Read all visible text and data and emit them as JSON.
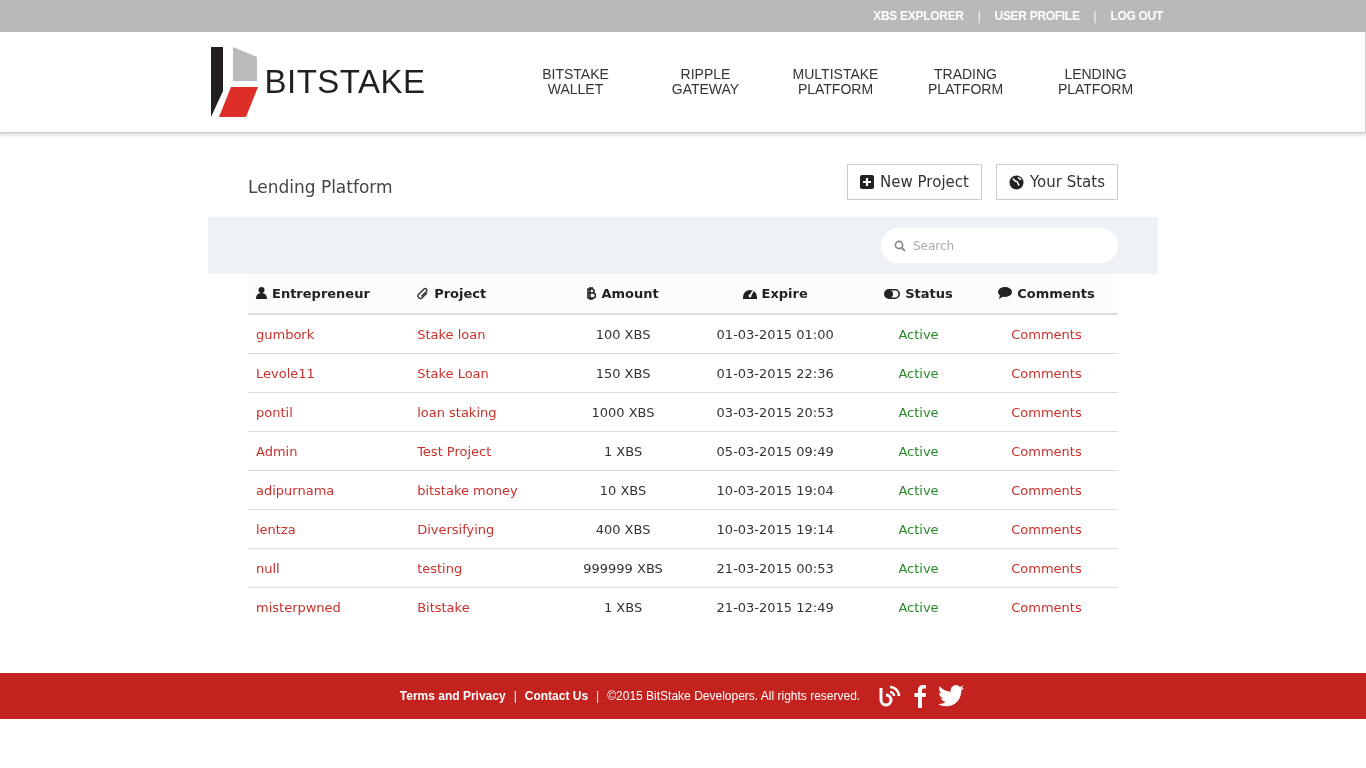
{
  "top_bar": {
    "items": [
      {
        "kind": "link",
        "text": "XBS EXPLORER"
      },
      {
        "kind": "sep",
        "text": "|"
      },
      {
        "kind": "link",
        "text": "USER PROFILE"
      },
      {
        "kind": "sep",
        "text": "|"
      },
      {
        "kind": "link",
        "text": "LOG OUT"
      }
    ]
  },
  "header": {
    "logo_text": "BITSTAKE",
    "nav": [
      [
        "BITSTAKE",
        "WALLET"
      ],
      [
        "RIPPLE",
        "GATEWAY"
      ],
      [
        "MULTISTAKE",
        "PLATFORM"
      ],
      [
        "TRADING",
        "PLATFORM"
      ],
      [
        "LENDING",
        "PLATFORM"
      ]
    ]
  },
  "page": {
    "title": "Lending Platform",
    "buttons": [
      {
        "kind": "new",
        "label": "New Project"
      },
      {
        "kind": "stats",
        "label": "Your Stats"
      }
    ],
    "search": {
      "placeholder": "Search"
    }
  },
  "table": {
    "columns": [
      {
        "kind": "user",
        "label": "Entrepreneur"
      },
      {
        "kind": "clip",
        "label": "Project"
      },
      {
        "kind": "coin",
        "label": "Amount"
      },
      {
        "kind": "gauge",
        "label": "Expire"
      },
      {
        "kind": "toggle",
        "label": "Status"
      },
      {
        "kind": "comment",
        "label": "Comments"
      }
    ],
    "rows": [
      {
        "entrepreneur": "gumbork",
        "project": "Stake loan",
        "amount": "100 XBS",
        "expire": "01-03-2015 01:00",
        "status": "Active",
        "comments": "Comments"
      },
      {
        "entrepreneur": "Levole11",
        "project": "Stake Loan",
        "amount": "150 XBS",
        "expire": "01-03-2015 22:36",
        "status": "Active",
        "comments": "Comments"
      },
      {
        "entrepreneur": "pontil",
        "project": "loan staking",
        "amount": "1000 XBS",
        "expire": "03-03-2015 20:53",
        "status": "Active",
        "comments": "Comments"
      },
      {
        "entrepreneur": "Admin",
        "project": "Test Project",
        "amount": "1 XBS",
        "expire": "05-03-2015 09:49",
        "status": "Active",
        "comments": "Comments"
      },
      {
        "entrepreneur": "adipurnama",
        "project": "bitstake money",
        "amount": "10 XBS",
        "expire": "10-03-2015 19:04",
        "status": "Active",
        "comments": "Comments"
      },
      {
        "entrepreneur": "lentza",
        "project": "Diversifying",
        "amount": "400 XBS",
        "expire": "10-03-2015 19:14",
        "status": "Active",
        "comments": "Comments"
      },
      {
        "entrepreneur": "null",
        "project": "testing",
        "amount": "999999 XBS",
        "expire": "21-03-2015 00:53",
        "status": "Active",
        "comments": "Comments"
      },
      {
        "entrepreneur": "misterpwned",
        "project": "Bitstake",
        "amount": "1 XBS",
        "expire": "21-03-2015 12:49",
        "status": "Active",
        "comments": "Comments"
      }
    ]
  },
  "footer": {
    "items": [
      {
        "kind": "link",
        "text": "Terms and Privacy"
      },
      {
        "kind": "sep",
        "text": "|"
      },
      {
        "kind": "link",
        "text": "Contact Us"
      },
      {
        "kind": "sep",
        "text": "|"
      },
      {
        "kind": "text",
        "text": "©2015 BitStake Developers. All rights reserved."
      }
    ]
  }
}
